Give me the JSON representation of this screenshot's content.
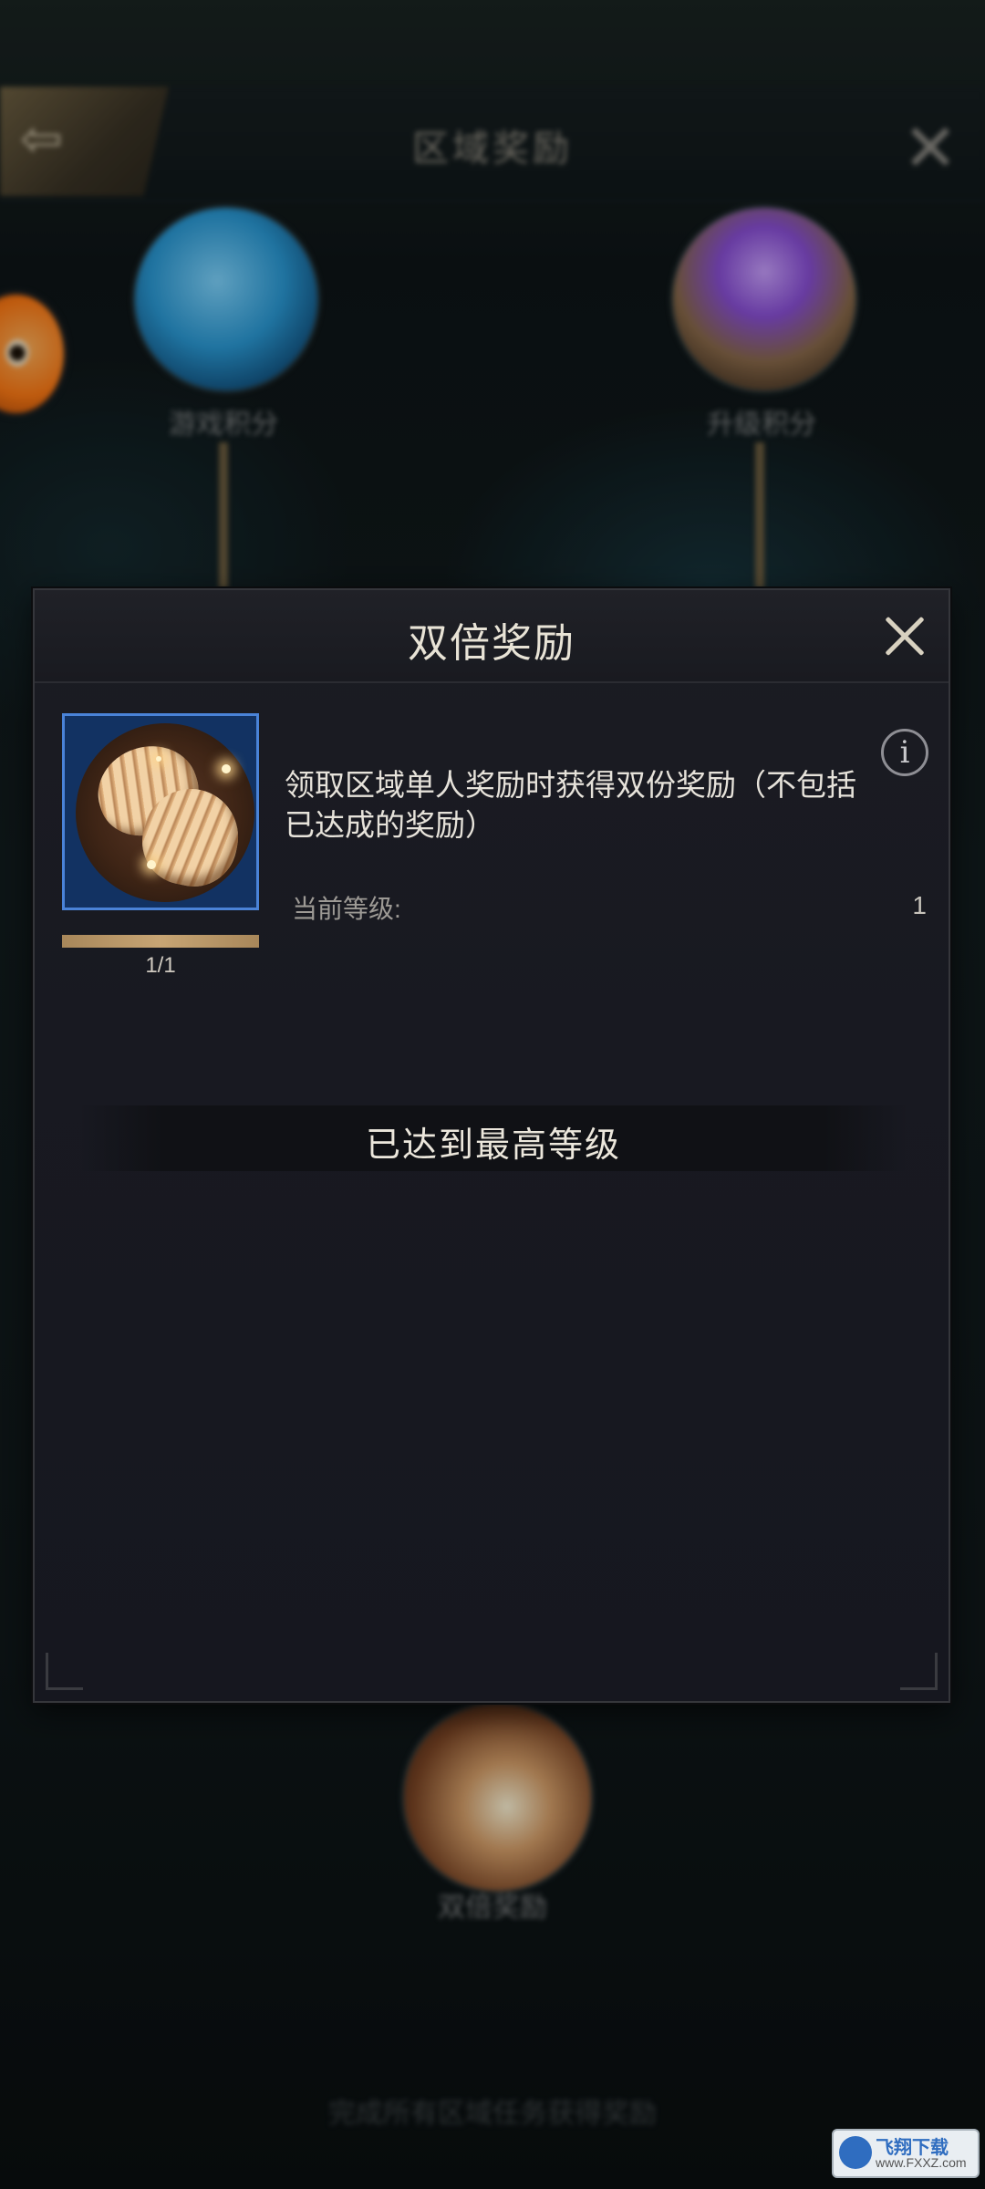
{
  "background": {
    "screen_title": "区域奖励",
    "node_left_label": "游戏积分",
    "node_right_label": "升级积分",
    "node_bottom_label": "双倍奖励",
    "bottom_hint": "完成所有区域任务获得奖励"
  },
  "modal": {
    "title": "双倍奖励",
    "close_icon": "close-icon",
    "item": {
      "icon": "shell-reward-icon",
      "progress_text": "1/1",
      "progress_fraction": 1.0
    },
    "description": "领取区域单人奖励时获得双份奖励（不包括已达成的奖励）",
    "info_icon_glyph": "i",
    "level_label": "当前等级:",
    "level_value": "1",
    "max_level_text": "已达到最高等级"
  },
  "watermark": {
    "text": "飞翔下载",
    "sub": "www.FXXZ.com"
  },
  "colors": {
    "frame_blue": "#4a83d8",
    "progress_gold": "#c7a574",
    "modal_bg": "#181921"
  }
}
